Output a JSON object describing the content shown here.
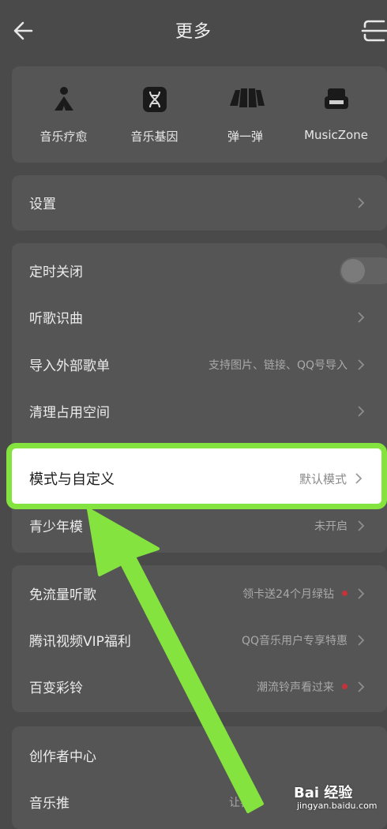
{
  "header": {
    "title": "更多"
  },
  "features": [
    {
      "label": "音乐疗愈",
      "icon": "meditation-icon"
    },
    {
      "label": "音乐基因",
      "icon": "dna-icon"
    },
    {
      "label": "弹一弹",
      "icon": "piano-keys-icon"
    },
    {
      "label": "MusicZone",
      "icon": "sofa-icon"
    }
  ],
  "settings": {
    "label": "设置"
  },
  "tools": [
    {
      "label": "定时关闭",
      "toggle_on": false
    },
    {
      "label": "听歌识曲"
    },
    {
      "label": "导入外部歌单",
      "hint": "支持图片、链接、QQ号导入"
    },
    {
      "label": "清理占用空间"
    },
    {
      "label": "模式与自定义",
      "hint": "默认模式"
    },
    {
      "label": "青少年模",
      "hint": "未开启"
    }
  ],
  "promos": [
    {
      "label": "免流量听歌",
      "hint": "领卡送24个月绿钻"
    },
    {
      "label": "腾讯视频VIP福利",
      "hint": "QQ音乐用户专享特惠"
    },
    {
      "label": "百变彩铃",
      "hint": "潮流铃声看过来"
    }
  ],
  "creator": [
    {
      "label": "创作者中心"
    },
    {
      "label": "音乐推",
      "hint": "让喜"
    }
  ],
  "watermark": {
    "line1": "Bai 经验",
    "line2": "jingyan.baidu.com"
  },
  "colors": {
    "highlight": "#84e33e",
    "arrow": "#84e33e",
    "badge": "#c4333a"
  }
}
